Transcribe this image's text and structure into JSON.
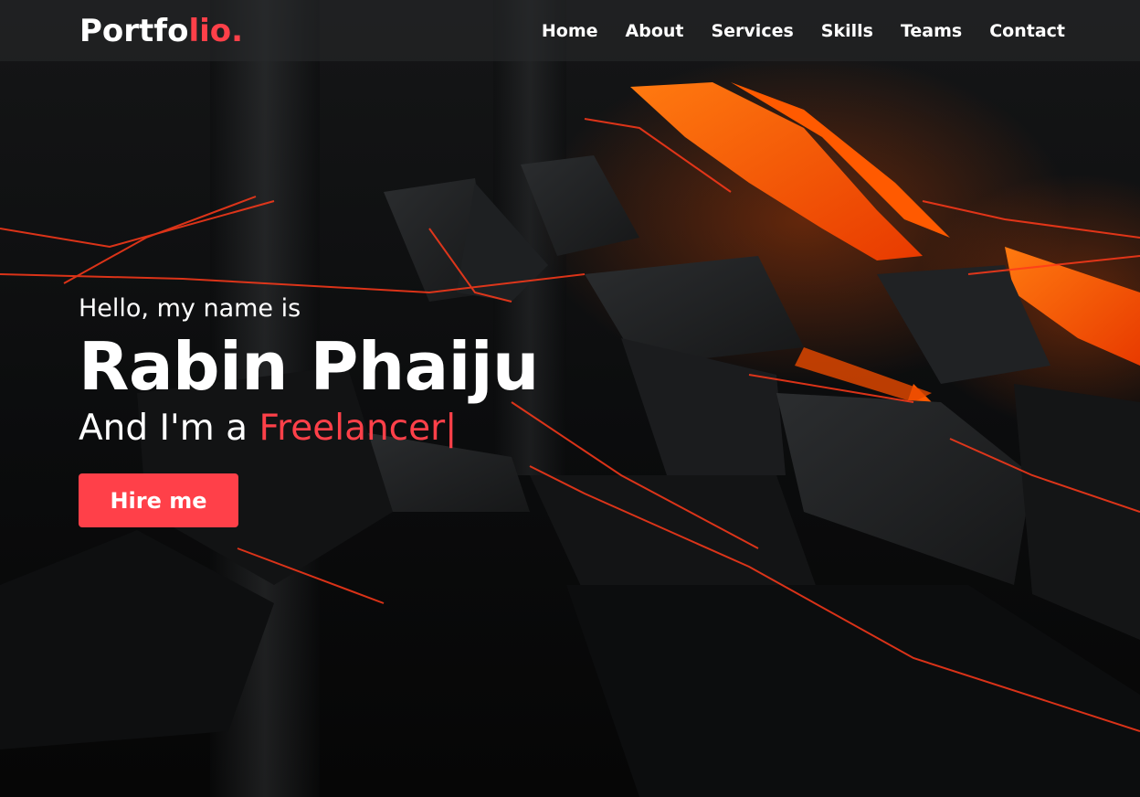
{
  "navbar": {
    "logo_main": "Portfo",
    "logo_accent": "lio.",
    "items": [
      {
        "label": "Home"
      },
      {
        "label": "About"
      },
      {
        "label": "Services"
      },
      {
        "label": "Skills"
      },
      {
        "label": "Teams"
      },
      {
        "label": "Contact"
      }
    ]
  },
  "hero": {
    "greeting": "Hello, my name is",
    "name": "Rabin Phaiju",
    "role_prefix": "And I'm a ",
    "role": "Freelancer",
    "cursor": "|",
    "cta_label": "Hire me"
  },
  "colors": {
    "accent": "#ff4049",
    "background": "#0b0c0d",
    "glow": "#ff5a00"
  }
}
